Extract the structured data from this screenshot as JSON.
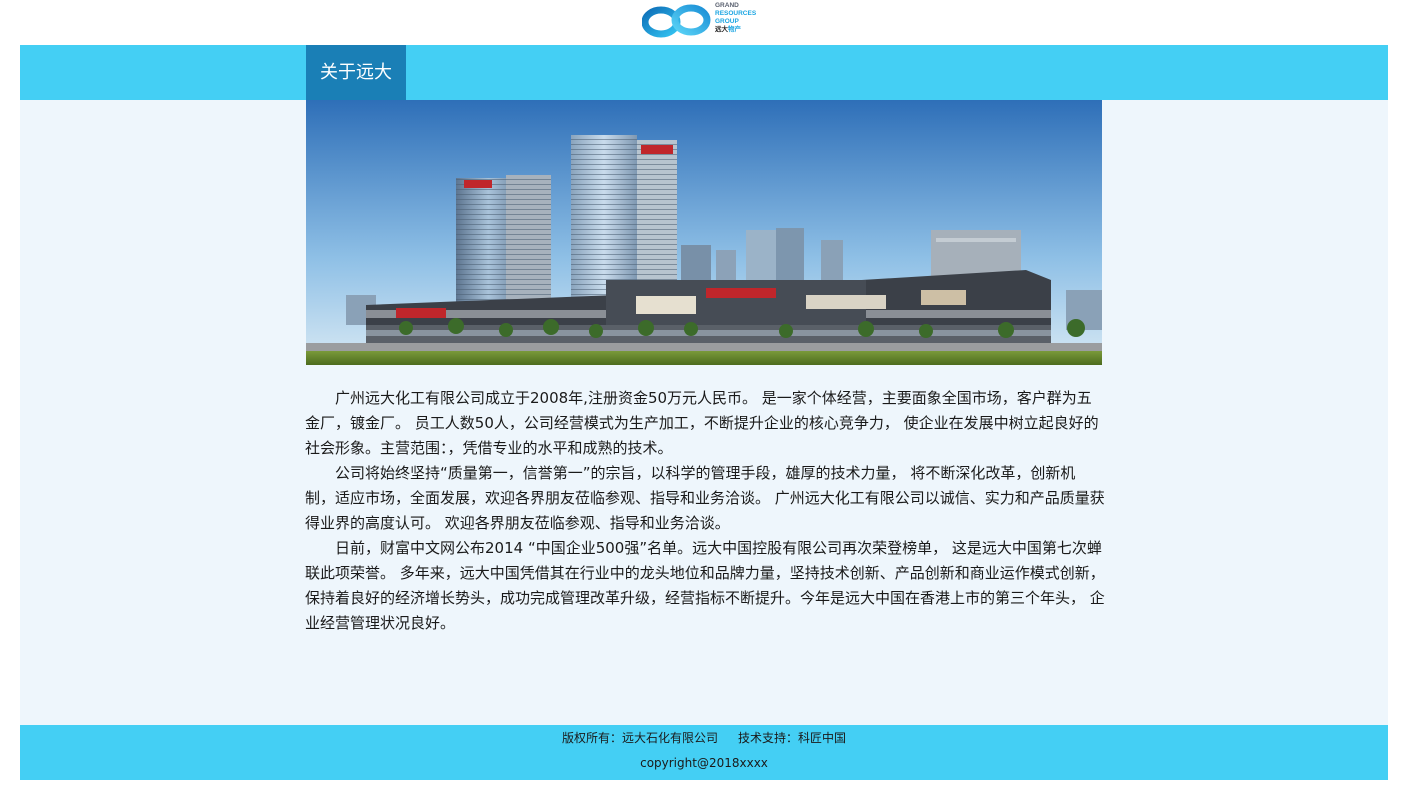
{
  "logo": {
    "line1": "GRAND",
    "line2": "RESOURCES",
    "line3": "GROUP",
    "line4a": "远大",
    "line4b": "物产"
  },
  "nav": {
    "active_tab": "关于远大"
  },
  "hero": {
    "description": "building-photo"
  },
  "article": {
    "paragraphs": [
      "广州远大化工有限公司成立于2008年,注册资金50万元人民币。 是一家个体经营，主要面象全国市场，客户群为五金厂，镀金厂。 员工人数50人，公司经营模式为生产加工，不断提升企业的核心竞争力， 使企业在发展中树立起良好的社会形象。主营范围：，凭借专业的水平和成熟的技术。",
      "公司将始终坚持“质量第一，信誉第一”的宗旨，以科学的管理手段，雄厚的技术力量， 将不断深化改革，创新机制，适应市场，全面发展，欢迎各界朋友莅临参观、指导和业务洽谈。 广州远大化工有限公司以诚信、实力和产品质量获得业界的高度认可。 欢迎各界朋友莅临参观、指导和业务洽谈。",
      "日前，财富中文网公布2014 “中国企业500强”名单。远大中国控股有限公司再次荣登榜单， 这是远大中国第七次蝉联此项荣誉。 多年来，远大中国凭借其在行业中的龙头地位和品牌力量，坚持技术创新、产品创新和商业运作模式创新， 保持着良好的经济增长势头，成功完成管理改革升级，经营指标不断提升。今年是远大中国在香港上市的第三个年头， 企业经营管理状况良好。"
    ]
  },
  "footer": {
    "copyright_owner": "版权所有：远大石化有限公司",
    "tech_support": "技术支持：科匠中国",
    "copyright": "copyright@2018xxxx"
  },
  "colors": {
    "nav_bar": "#44cff4",
    "nav_active": "#1a7fb6",
    "content_bg": "#eef6fc",
    "logo_blue": "#1aa5e2"
  }
}
